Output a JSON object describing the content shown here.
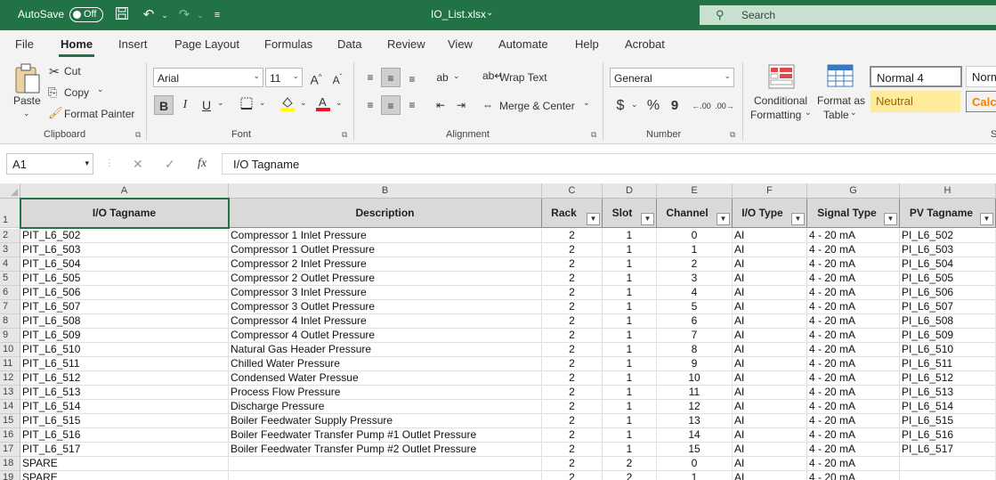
{
  "titlebar": {
    "autosave_label": "AutoSave",
    "autosave_state": "Off",
    "filename": "IO_List.xlsx",
    "search_placeholder": "Search"
  },
  "tabs": [
    "File",
    "Home",
    "Insert",
    "Page Layout",
    "Formulas",
    "Data",
    "Review",
    "View",
    "Automate",
    "Help",
    "Acrobat"
  ],
  "active_tab": "Home",
  "ribbon": {
    "clipboard": {
      "paste": "Paste",
      "cut": "Cut",
      "copy": "Copy",
      "format_painter": "Format Painter",
      "group": "Clipboard"
    },
    "font": {
      "name": "Arial",
      "size": "11",
      "group": "Font",
      "bold": "B",
      "italic": "I",
      "underline": "U"
    },
    "alignment": {
      "wrap_text": "Wrap Text",
      "merge_center": "Merge & Center",
      "group": "Alignment"
    },
    "number": {
      "format": "General",
      "group": "Number",
      "currency": "$",
      "percent": "%",
      "comma": "9",
      "inc_dec": ".00",
      "dec_dec": ".00"
    },
    "styles": {
      "conditional_formatting_1": "Conditional",
      "conditional_formatting_2": "Formatting",
      "format_as_table_1": "Format as",
      "format_as_table_2": "Table",
      "normal4": "Normal 4",
      "normal": "Norm",
      "neutral": "Neutral",
      "calculation": "Calcu",
      "group_letter": "S"
    }
  },
  "formula_bar": {
    "name_box": "A1",
    "formula": "I/O Tagname"
  },
  "columns": [
    "A",
    "B",
    "C",
    "D",
    "E",
    "F",
    "G",
    "H"
  ],
  "headers": [
    "I/O Tagname",
    "Description",
    "Rack",
    "Slot",
    "Channel",
    "I/O Type",
    "Signal Type",
    "PV Tagname"
  ],
  "rows": [
    {
      "n": "2",
      "c": [
        "PIT_L6_502",
        "Compressor 1 Inlet Pressure",
        "2",
        "1",
        "0",
        "AI",
        "4 - 20 mA",
        "PI_L6_502"
      ]
    },
    {
      "n": "3",
      "c": [
        "PIT_L6_503",
        "Compressor 1 Outlet Pressure",
        "2",
        "1",
        "1",
        "AI",
        "4 - 20 mA",
        "PI_L6_503"
      ]
    },
    {
      "n": "4",
      "c": [
        "PIT_L6_504",
        "Compressor 2 Inlet Pressure",
        "2",
        "1",
        "2",
        "AI",
        "4 - 20 mA",
        "PI_L6_504"
      ]
    },
    {
      "n": "5",
      "c": [
        "PIT_L6_505",
        "Compressor 2 Outlet Pressure",
        "2",
        "1",
        "3",
        "AI",
        "4 - 20 mA",
        "PI_L6_505"
      ]
    },
    {
      "n": "6",
      "c": [
        "PIT_L6_506",
        "Compressor 3 Inlet Pressure",
        "2",
        "1",
        "4",
        "AI",
        "4 - 20 mA",
        "PI_L6_506"
      ]
    },
    {
      "n": "7",
      "c": [
        "PIT_L6_507",
        "Compressor 3 Outlet Pressure",
        "2",
        "1",
        "5",
        "AI",
        "4 - 20 mA",
        "PI_L6_507"
      ]
    },
    {
      "n": "8",
      "c": [
        "PIT_L6_508",
        "Compressor 4 Inlet Pressure",
        "2",
        "1",
        "6",
        "AI",
        "4 - 20 mA",
        "PI_L6_508"
      ]
    },
    {
      "n": "9",
      "c": [
        "PIT_L6_509",
        "Compressor 4 Outlet Pressure",
        "2",
        "1",
        "7",
        "AI",
        "4 - 20 mA",
        "PI_L6_509"
      ]
    },
    {
      "n": "10",
      "c": [
        "PIT_L6_510",
        "Natural Gas Header Pressure",
        "2",
        "1",
        "8",
        "AI",
        "4 - 20 mA",
        "PI_L6_510"
      ]
    },
    {
      "n": "11",
      "c": [
        "PIT_L6_511",
        "Chilled Water Pressure",
        "2",
        "1",
        "9",
        "AI",
        "4 - 20 mA",
        "PI_L6_511"
      ]
    },
    {
      "n": "12",
      "c": [
        "PIT_L6_512",
        "Condensed Water Pressue",
        "2",
        "1",
        "10",
        "AI",
        "4 - 20 mA",
        "PI_L6_512"
      ]
    },
    {
      "n": "13",
      "c": [
        "PIT_L6_513",
        "Process Flow Pressure",
        "2",
        "1",
        "11",
        "AI",
        "4 - 20 mA",
        "PI_L6_513"
      ]
    },
    {
      "n": "14",
      "c": [
        "PIT_L6_514",
        "Discharge Pressure",
        "2",
        "1",
        "12",
        "AI",
        "4 - 20 mA",
        "PI_L6_514"
      ]
    },
    {
      "n": "15",
      "c": [
        "PIT_L6_515",
        "Boiler Feedwater Supply Pressure",
        "2",
        "1",
        "13",
        "AI",
        "4 - 20 mA",
        "PI_L6_515"
      ]
    },
    {
      "n": "16",
      "c": [
        "PIT_L6_516",
        "Boiler Feedwater Transfer Pump #1 Outlet Pressure",
        "2",
        "1",
        "14",
        "AI",
        "4 - 20 mA",
        "PI_L6_516"
      ]
    },
    {
      "n": "17",
      "c": [
        "PIT_L6_517",
        "Boiler Feedwater Transfer Pump #2 Outlet Pressure",
        "2",
        "1",
        "15",
        "AI",
        "4 - 20 mA",
        "PI_L6_517"
      ]
    },
    {
      "n": "18",
      "c": [
        "SPARE",
        "",
        "2",
        "2",
        "0",
        "AI",
        "4 - 20 mA",
        ""
      ]
    },
    {
      "n": "19",
      "c": [
        "SPARE",
        "",
        "2",
        "2",
        "1",
        "AI",
        "4 - 20 mA",
        ""
      ]
    }
  ],
  "colors": {
    "excel_green": "#217346",
    "header_fill": "#d9d9d9",
    "neutral_fill": "#ffeb9c",
    "calc_fill": "#f2f2f2"
  }
}
